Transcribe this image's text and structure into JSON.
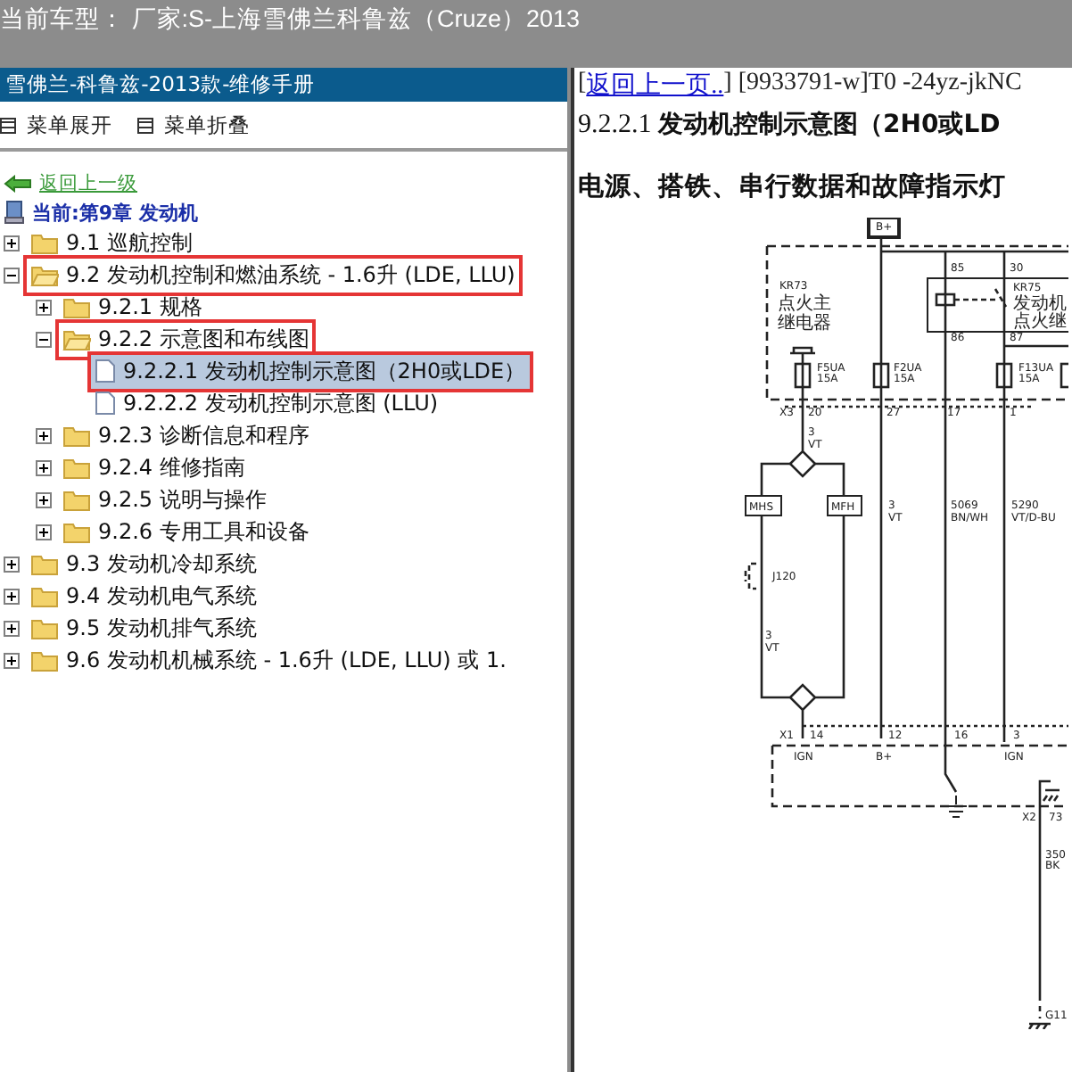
{
  "top_bar": {
    "text": "当前车型： 厂家:S-上海雪佛兰科鲁兹（Cruze）2013"
  },
  "sidebar": {
    "title": "雪佛兰-科鲁兹-2013款-维修手册",
    "menu_actions": [
      "菜单展开",
      "菜单折叠"
    ],
    "back_link": "返回上一级",
    "current": "当前:第9章 发动机",
    "tree": [
      {
        "label": "9.1 巡航控制",
        "kind": "folder",
        "expanded": false,
        "selected": false,
        "marked": false
      },
      {
        "label": "9.2 发动机控制和燃油系统 - 1.6升 (LDE, LLU)",
        "kind": "folder",
        "expanded": true,
        "selected": false,
        "marked": true,
        "children": [
          {
            "label": "9.2.1 规格",
            "kind": "folder",
            "expanded": false,
            "selected": false,
            "marked": false
          },
          {
            "label": "9.2.2 示意图和布线图",
            "kind": "folder",
            "expanded": true,
            "selected": false,
            "marked": true,
            "children": [
              {
                "label": "9.2.2.1 发动机控制示意图（2H0或LDE）",
                "kind": "page",
                "selected": true,
                "marked": true
              },
              {
                "label": "9.2.2.2 发动机控制示意图 (LLU)",
                "kind": "page",
                "selected": false,
                "marked": false
              }
            ]
          },
          {
            "label": "9.2.3 诊断信息和程序",
            "kind": "folder",
            "expanded": false,
            "selected": false,
            "marked": false
          },
          {
            "label": "9.2.4 维修指南",
            "kind": "folder",
            "expanded": false,
            "selected": false,
            "marked": false
          },
          {
            "label": "9.2.5 说明与操作",
            "kind": "folder",
            "expanded": false,
            "selected": false,
            "marked": false
          },
          {
            "label": "9.2.6 专用工具和设备",
            "kind": "folder",
            "expanded": false,
            "selected": false,
            "marked": false
          }
        ]
      },
      {
        "label": "9.3 发动机冷却系统",
        "kind": "folder",
        "expanded": false,
        "selected": false,
        "marked": false
      },
      {
        "label": "9.4 发动机电气系统",
        "kind": "folder",
        "expanded": false,
        "selected": false,
        "marked": false
      },
      {
        "label": "9.5 发动机排气系统",
        "kind": "folder",
        "expanded": false,
        "selected": false,
        "marked": false
      },
      {
        "label": "9.6 发动机机械系统 - 1.6升 (LDE, LLU) 或 1.",
        "kind": "folder",
        "expanded": false,
        "selected": false,
        "marked": false
      }
    ]
  },
  "content": {
    "link_prefix": "[",
    "back_link": "返回上一页..",
    "link_suffix": "] [9933791-w]T0 -24yz-jkNC",
    "heading": "9.2.2.1 **发动机控制示意图（2H0或LD**",
    "subheading": "电源、搭铁、串行数据和故障指示灯",
    "diagram": {
      "labels": [
        "B+",
        "KR73",
        "点火主",
        "继电器",
        "F5UA",
        "15A",
        "F2UA",
        "15A",
        "85",
        "30",
        "KR75",
        "发动机",
        "点火继",
        "86",
        "87",
        "F13UA",
        "15A",
        "X3",
        "20",
        "27",
        "17",
        "1",
        "3",
        "VT",
        "MHS",
        "MFH",
        "3",
        "VT",
        "5069",
        "BN/WH",
        "5290",
        "VT/D-BU",
        "J120",
        "3",
        "VT",
        "X1",
        "14",
        "12",
        "16",
        "3",
        "IGN",
        "B+",
        "IGN",
        "X2",
        "73",
        "350",
        "BK",
        "G11"
      ]
    }
  }
}
